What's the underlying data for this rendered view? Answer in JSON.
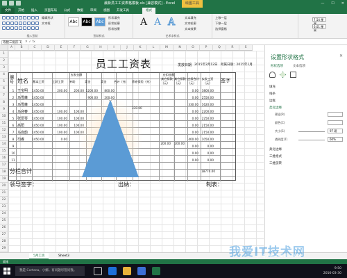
{
  "window": {
    "title": "最新员工工资表格模板.xls [兼容模式] - Excel",
    "context_tab": "绘图工具",
    "min": "—",
    "max": "☐",
    "close": "✕"
  },
  "ribbon_tabs": [
    "文件",
    "开始",
    "插入",
    "页面布局",
    "公式",
    "数据",
    "审阅",
    "视图",
    "开发工具",
    "格式"
  ],
  "ribbon": {
    "group_insert_shapes": "插入形状",
    "group_shape_styles": "形状样式",
    "group_wordart": "艺术字样式",
    "edit_shape": "编辑形状",
    "textbox": "文本框",
    "shape_fill": "形状填充",
    "shape_outline": "形状轮廓",
    "shape_effects": "形状效果",
    "text_fill": "文本填充",
    "text_outline": "文本轮廓",
    "text_effects": "文本效果",
    "bring_forward": "上移一层",
    "send_backward": "下移一层",
    "selection_pane": "选择窗格",
    "height": "7.54 厘米",
    "width": "6.01 厘米",
    "abc": "Abc",
    "wordart_a": "A"
  },
  "formula_bar": {
    "name_box": "等腰三角形 1",
    "cancel": "✕",
    "enter": "✓",
    "fx": "fx"
  },
  "columns": [
    "A",
    "B",
    "C",
    "D",
    "E",
    "F",
    "G",
    "H",
    "I",
    "J",
    "K",
    "L",
    "M",
    "N",
    "O",
    "P",
    "Q",
    "R",
    "S",
    "T",
    "U",
    "V"
  ],
  "rows": [
    "1",
    "2",
    "3",
    "4",
    "5",
    "6",
    "7",
    "8",
    "9",
    "10",
    "11",
    "12",
    "13",
    "14",
    "15",
    "16",
    "17",
    "18",
    "19",
    "20",
    "21",
    "22",
    "23",
    "24",
    "25",
    "26",
    "27",
    "28",
    "29"
  ],
  "sheet": {
    "title": "员工工资表",
    "issue_date_label": "发放日期",
    "issue_date_value": "2015年2月12日",
    "period_value": "所属日期：2015年1月",
    "h_no": "编号",
    "h_name": "姓名",
    "h_payable": "应发金额",
    "h_deduct": "应扣金额",
    "h_base": "基本工资",
    "h_senior": "工龄工资",
    "h_subsidy": "补助",
    "h_bonus": "奖金",
    "h_award": "奖金",
    "h_total": "合计（元）",
    "h_social": "养老保险（元）",
    "h_other1": "其它扣款（元）",
    "h_other2": "其它扣款（元）",
    "h_deduct_total": "应扣合计（元）",
    "h_net": "实发工资（元）",
    "h_sign": "签字",
    "subtotal": "分栏合计",
    "sign_leader": "领导签字：",
    "cashier": "出纳：",
    "preparer": "制表：",
    "employees": [
      {
        "no": "1",
        "name": "王宝明",
        "base": "1450.00",
        "senior": "200.00",
        "subsidy": "200.00",
        "bonus": "1200.00",
        "award": "800.00",
        "deduct_total": "0.00",
        "net": "3800.00"
      },
      {
        "no": "2",
        "name": "马雪峰",
        "base": "1450.00",
        "senior": "",
        "subsidy": "",
        "bonus": "900.00",
        "award": "200.00",
        "deduct_total": "0.00",
        "net": "2550.00"
      },
      {
        "no": "3",
        "name": "马雪峰",
        "base": "1450.00",
        "senior": "",
        "subsidy": "",
        "bonus": "",
        "award": "",
        "deduct_total": "330.00",
        "net": "1620.00"
      },
      {
        "no": "4",
        "name": "马迎春",
        "base": "1450.00",
        "senior": "100.00",
        "subsidy": "100.00",
        "bonus": "",
        "award": "",
        "deduct_total": "0.00",
        "net": "2200.00"
      },
      {
        "no": "5",
        "name": "张爱琴",
        "base": "1450.00",
        "senior": "100.00",
        "subsidy": "100.00",
        "bonus": "",
        "award": "",
        "deduct_total": "0.00",
        "net": "2250.00"
      },
      {
        "no": "6",
        "name": "高阳",
        "base": "1450.00",
        "senior": "100.00",
        "subsidy": "100.00",
        "bonus": "",
        "award": "",
        "deduct_total": "0.00",
        "net": "2150.00"
      },
      {
        "no": "7",
        "name": "马自韵",
        "base": "1450.00",
        "senior": "100.00",
        "subsidy": "100.00",
        "bonus": "",
        "award": "",
        "deduct_total": "0.00",
        "net": "2150.00"
      },
      {
        "no": "8",
        "name": "司睿",
        "base": "1450.00",
        "senior": "0.00",
        "subsidy": "",
        "bonus": "",
        "award": "",
        "deduct_total": "400.00",
        "net": "1050.00"
      },
      {
        "no": "9",
        "name": "",
        "base": "",
        "senior": "",
        "subsidy": "",
        "bonus": "",
        "award": "",
        "deduct_total": "0.00",
        "net": "0.00"
      },
      {
        "no": "10",
        "name": "",
        "base": "",
        "senior": "",
        "subsidy": "",
        "bonus": "",
        "award": "",
        "deduct_total": "0.00",
        "net": "0.00"
      },
      {
        "no": "11",
        "name": "",
        "base": "",
        "senior": "",
        "subsidy": "",
        "bonus": "",
        "award": "",
        "deduct_total": "0.00",
        "net": "0.00"
      },
      {
        "no": "12",
        "name": "",
        "base": "",
        "senior": "",
        "subsidy": "",
        "bonus": "",
        "award": "",
        "deduct_total": "0.00",
        "net": "0.00"
      },
      {
        "no": "13",
        "name": "",
        "base": "",
        "senior": "",
        "subsidy": "",
        "bonus": "",
        "award": "",
        "deduct_total": "0.00",
        "net": "0.00"
      }
    ],
    "extra_330": "330.00",
    "extra_200a": "200.00",
    "extra_200b": "200.00",
    "grand_net": "18770.00"
  },
  "shape_color": "#5b9bd5",
  "accent": "#217346",
  "pane": {
    "title": "设置形状格式",
    "close": "✕",
    "tab_shape": "形状选项",
    "tab_text": "文本选项",
    "fill": "填充",
    "line": "线条",
    "border": "边框",
    "preset": "预设(R)",
    "color": "颜色(C)",
    "size": "大小(S)",
    "size_value": "97 磅",
    "transparency": "透明度(T)",
    "transparency_value": "60%",
    "soft_edges": "柔化边缘",
    "three_d_format": "三维格式",
    "three_d_rotation": "三维旋转"
  },
  "sheet_tabs": [
    "5月工资",
    "Sheet3"
  ],
  "status": "就绪",
  "taskbar": {
    "search": "我是 Cortana，小娜。有问题尽管问我。",
    "time": "9:50",
    "date": "2016-03-30"
  },
  "watermark": "我爱IT技术网",
  "watermark_url": "jingyan.baidu.com"
}
